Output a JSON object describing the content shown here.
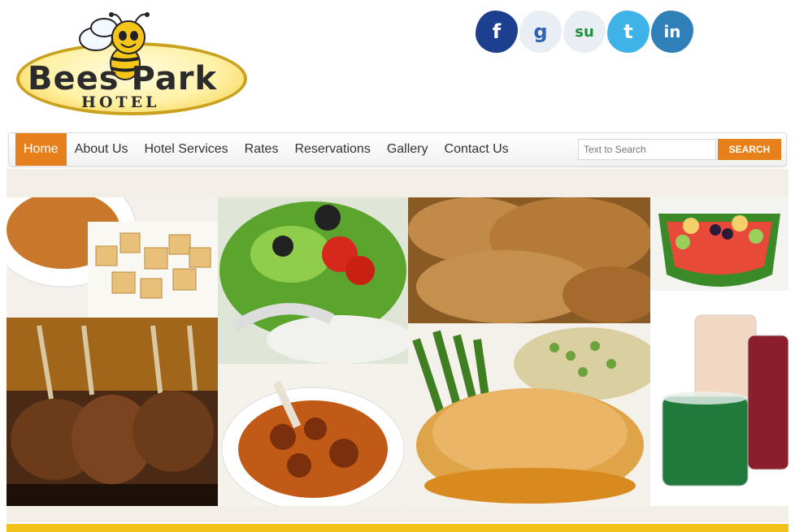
{
  "logo": {
    "title": "Bees Park",
    "subtitle": "HOTEL"
  },
  "social": [
    {
      "name": "facebook",
      "glyph": "f"
    },
    {
      "name": "google",
      "glyph": "g"
    },
    {
      "name": "stumbleupon",
      "glyph": "su"
    },
    {
      "name": "twitter",
      "glyph": "t"
    },
    {
      "name": "linkedin",
      "glyph": "in"
    }
  ],
  "nav": {
    "items": [
      "Home",
      "About Us",
      "Hotel Services",
      "Rates",
      "Reservations",
      "Gallery",
      "Contact Us"
    ],
    "active": "Home"
  },
  "search": {
    "placeholder": "Text to Search",
    "button": "SEARCH"
  },
  "colors": {
    "accent": "#e7801a",
    "footer": "#f2c21a",
    "band": "#f3efe6"
  }
}
